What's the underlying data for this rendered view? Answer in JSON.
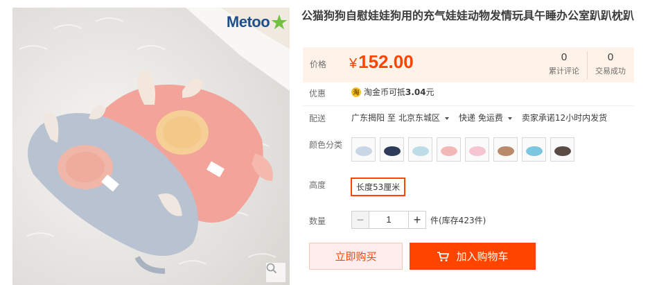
{
  "product": {
    "brand": "Metoo",
    "title": "公猫狗狗自慰娃娃狗用的充气娃娃动物发情玩具午睡办公室趴趴枕趴"
  },
  "price": {
    "label": "价格",
    "currency": "¥",
    "value": "152.00",
    "stats": [
      {
        "count": "0",
        "label": "累计评论"
      },
      {
        "count": "0",
        "label": "交易成功"
      }
    ]
  },
  "promo": {
    "label": "优惠",
    "icon": "taobao-coin-icon",
    "text_prefix": "淘金币可抵",
    "amount": "3.04",
    "text_suffix": "元"
  },
  "shipping": {
    "label": "配送",
    "from": "广东揭阳",
    "to_word": "至",
    "destination": "北京东城区",
    "method": "快递 免运费",
    "promise": "卖家承诺12小时内发货"
  },
  "color": {
    "label": "颜色分类",
    "swatch_colors": [
      "#c9d6e6",
      "#2d3a5a",
      "#bcdde8",
      "#f2b8b8",
      "#f5c6d2",
      "#b98a6a",
      "#7cc6e0",
      "#5a4a44"
    ]
  },
  "size": {
    "label": "高度",
    "selected": "长度53厘米"
  },
  "quantity": {
    "label": "数量",
    "value": "1",
    "minus": "−",
    "plus": "+",
    "stock_text": "件(库存423件)"
  },
  "actions": {
    "buy_now": "立即购买",
    "add_to_cart": "加入购物车"
  },
  "colors": {
    "accent": "#ff4400",
    "price_bg": "#fff2e8",
    "buy_bg": "#ffeded"
  }
}
